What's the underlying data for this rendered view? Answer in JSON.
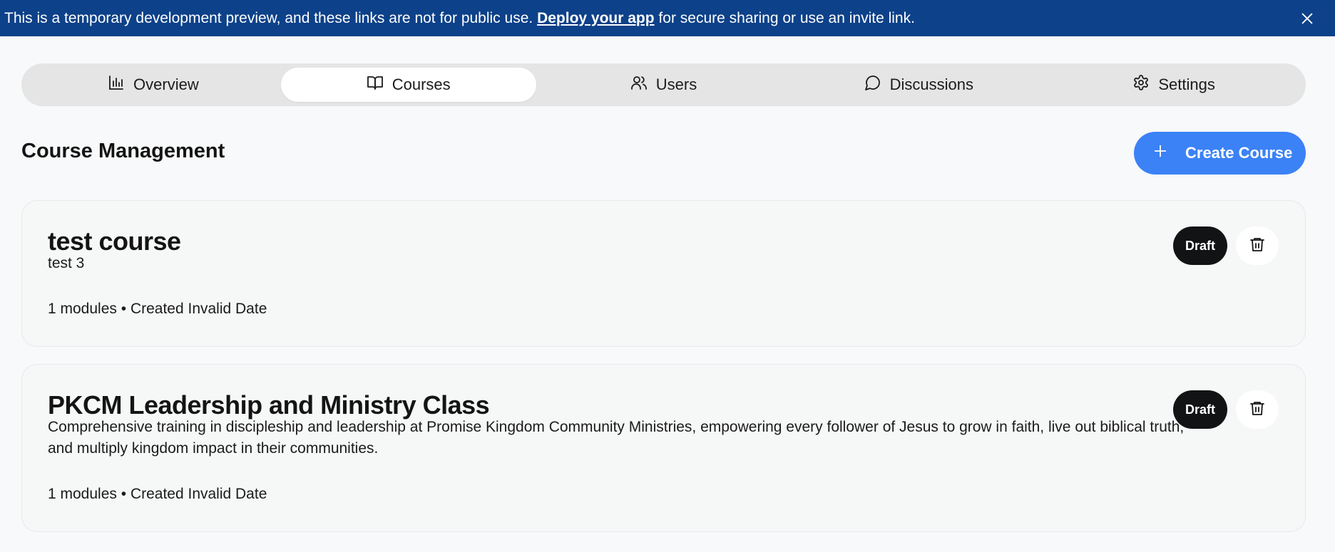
{
  "banner": {
    "text_before": "This is a temporary development preview, and these links are not for public use. ",
    "link_label": "Deploy your app",
    "text_after": " for secure sharing or use an invite link.",
    "close_icon": "x-icon"
  },
  "tabs": [
    {
      "label": "Overview",
      "icon": "bar-chart-icon",
      "active": false
    },
    {
      "label": "Courses",
      "icon": "book-open-icon",
      "active": true
    },
    {
      "label": "Users",
      "icon": "users-icon",
      "active": false
    },
    {
      "label": "Discussions",
      "icon": "message-circle-icon",
      "active": false
    },
    {
      "label": "Settings",
      "icon": "gear-icon",
      "active": false
    }
  ],
  "page": {
    "title": "Course Management",
    "create_button_label": "Create Course",
    "create_button_icon": "plus-icon"
  },
  "courses": [
    {
      "title": "test course",
      "description": "test 3",
      "modules": "1 modules",
      "separator": "•",
      "created": "Created Invalid Date",
      "status": "Draft",
      "delete_icon": "trash-icon"
    },
    {
      "title": "PKCM Leadership and Ministry Class",
      "description": "Comprehensive training in discipleship and leadership at Promise Kingdom Community Ministries, empowering every follower of Jesus to grow in faith, live out biblical truth, and multiply kingdom impact in their communities.",
      "modules": "1 modules",
      "separator": "•",
      "created": "Created Invalid Date",
      "status": "Draft",
      "delete_icon": "trash-icon"
    }
  ],
  "colors": {
    "banner_bg": "#0d4189",
    "accent": "#3b82f6",
    "badge_bg": "#111315",
    "page_bg": "#f8f9fa"
  }
}
